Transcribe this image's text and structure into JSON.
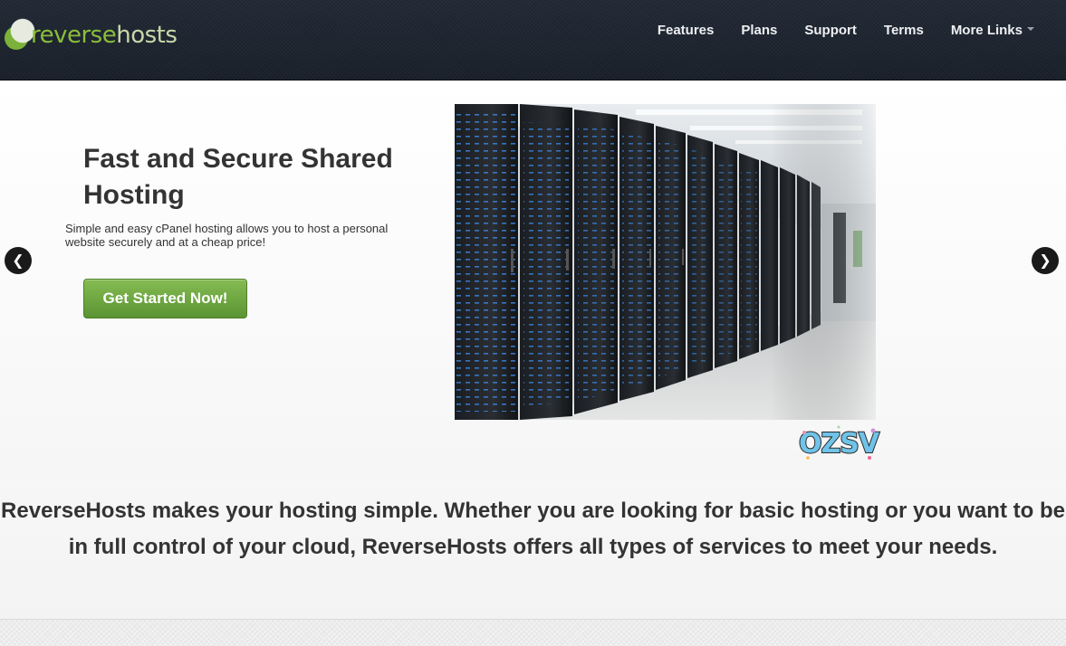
{
  "brand": {
    "logo_part1": "reverse",
    "logo_part2": "hosts",
    "logo_icon": "green-circle-logo-icon"
  },
  "nav": {
    "items": [
      {
        "label": "Features"
      },
      {
        "label": "Plans"
      },
      {
        "label": "Support"
      },
      {
        "label": "Terms"
      },
      {
        "label": "More Links",
        "dropdown": true
      }
    ]
  },
  "hero": {
    "title": "Fast and Secure Shared Hosting",
    "subtitle": "Simple and easy cPanel hosting allows you to host a personal website securely and at a cheap price!",
    "cta_label": "Get Started Now!",
    "prev_label": "❮",
    "next_label": "❯",
    "image_icon": "server-racks-photo"
  },
  "badge": {
    "text": "OZSV"
  },
  "intro": {
    "text": "ReverseHosts makes your hosting simple. Whether you are looking for basic hosting or you want to be in full control of your cloud, ReverseHosts offers all types of services to meet your needs."
  },
  "colors": {
    "navbar_bg": "#1e2530",
    "brand_green": "#8bbd3a",
    "button_green": "#6ea542",
    "text_dark": "#333333"
  }
}
